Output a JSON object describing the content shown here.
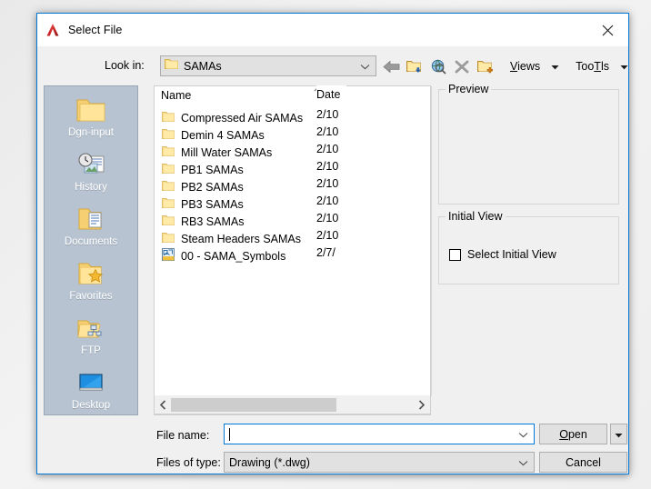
{
  "window": {
    "title": "Select File",
    "logo_icon": "autocad-logo-icon",
    "close_icon": "close-icon",
    "border_color": "#0078d7"
  },
  "lookin": {
    "label": "Look in:",
    "value": "SAMAs",
    "folder_icon": "folder-icon",
    "chevron_icon": "chevron-down-icon"
  },
  "toolbar": {
    "back_icon": "back-arrow-icon",
    "up_icon": "up-one-level-folder-icon",
    "search_icon": "search-web-icon",
    "delete_icon": "delete-x-icon",
    "newfolder_icon": "new-folder-icon",
    "views_label": "Views",
    "views_accel": "V",
    "tools_label": "Tools",
    "tools_accel": "T",
    "arrow_icon": "dropdown-arrow-icon"
  },
  "places": {
    "items": [
      {
        "label": "Dgn-input",
        "icon": "folder-icon"
      },
      {
        "label": "History",
        "icon": "history-clock-icon"
      },
      {
        "label": "Documents",
        "icon": "documents-folder-icon"
      },
      {
        "label": "Favorites",
        "icon": "favorites-star-folder-icon"
      },
      {
        "label": "FTP",
        "icon": "ftp-network-folder-icon"
      },
      {
        "label": "Desktop",
        "icon": "desktop-monitor-icon"
      }
    ]
  },
  "filelist": {
    "columns": [
      "Name",
      "Date"
    ],
    "sort_icon": "sort-ascending-caret-icon",
    "items": [
      {
        "name": "Compressed Air SAMAs",
        "date": "2/10",
        "icon": "folder-icon"
      },
      {
        "name": "Demin 4 SAMAs",
        "date": "2/10",
        "icon": "folder-icon"
      },
      {
        "name": "Mill Water SAMAs",
        "date": "2/10",
        "icon": "folder-icon"
      },
      {
        "name": "PB1 SAMAs",
        "date": "2/10",
        "icon": "folder-icon"
      },
      {
        "name": "PB2 SAMAs",
        "date": "2/10",
        "icon": "folder-icon"
      },
      {
        "name": "PB3 SAMAs",
        "date": "2/10",
        "icon": "folder-icon"
      },
      {
        "name": "RB3 SAMAs",
        "date": "2/10",
        "icon": "folder-icon"
      },
      {
        "name": "Steam Headers SAMAs",
        "date": "2/10",
        "icon": "folder-icon"
      },
      {
        "name": "00 - SAMA_Symbols",
        "date": "2/7/",
        "icon": "dwg-drawing-file-icon"
      }
    ],
    "scrollbar": {
      "left_icon": "scroll-left-icon",
      "right_icon": "scroll-right-icon"
    }
  },
  "preview": {
    "legend": "Preview",
    "content": ""
  },
  "initial_view": {
    "legend": "Initial View",
    "checkbox_label": "Select Initial View",
    "checked": false
  },
  "bottom": {
    "filename_label": "File name:",
    "filename_value": "",
    "filename_chevron": "chevron-down-icon",
    "filetype_label": "Files of type:",
    "filetype_value": "Drawing (*.dwg)",
    "filetype_chevron": "chevron-down-icon",
    "open_label": "Open",
    "open_accel": "O",
    "open_dropdown_icon": "dropdown-arrow-icon",
    "cancel_label": "Cancel"
  }
}
